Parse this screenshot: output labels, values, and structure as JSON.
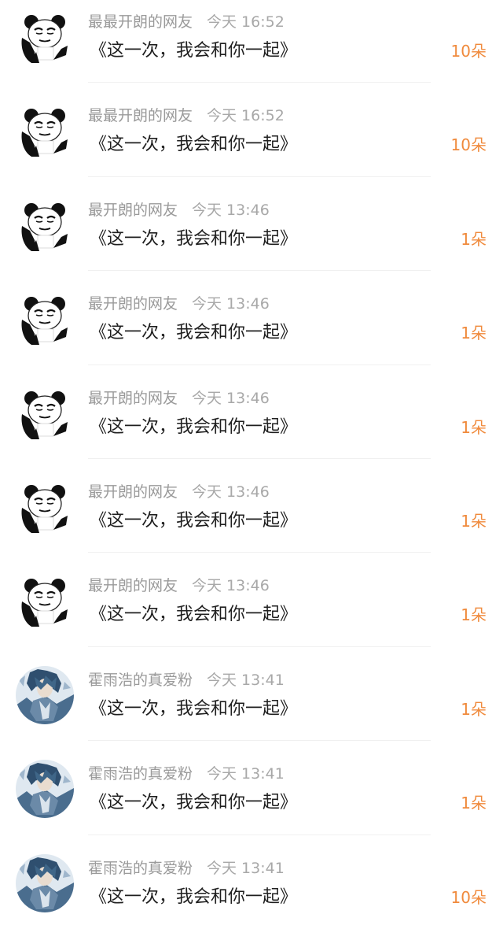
{
  "messages": [
    {
      "user": "最最开朗的网友",
      "time": "今天 16:52",
      "title": "《这一次，我会和你一起》",
      "gifts": "10朵",
      "avatar": "panda-avatar"
    },
    {
      "user": "最最开朗的网友",
      "time": "今天 16:52",
      "title": "《这一次，我会和你一起》",
      "gifts": "10朵",
      "avatar": "panda-avatar"
    },
    {
      "user": "最开朗的网友",
      "time": "今天 13:46",
      "title": "《这一次，我会和你一起》",
      "gifts": "1朵",
      "avatar": "panda-avatar"
    },
    {
      "user": "最开朗的网友",
      "time": "今天 13:46",
      "title": "《这一次，我会和你一起》",
      "gifts": "1朵",
      "avatar": "panda-avatar"
    },
    {
      "user": "最开朗的网友",
      "time": "今天 13:46",
      "title": "《这一次，我会和你一起》",
      "gifts": "1朵",
      "avatar": "panda-avatar"
    },
    {
      "user": "最开朗的网友",
      "time": "今天 13:46",
      "title": "《这一次，我会和你一起》",
      "gifts": "1朵",
      "avatar": "panda-avatar"
    },
    {
      "user": "最开朗的网友",
      "time": "今天 13:46",
      "title": "《这一次，我会和你一起》",
      "gifts": "1朵",
      "avatar": "panda-avatar"
    },
    {
      "user": "霍雨浩的真爱粉",
      "time": "今天 13:41",
      "title": "《这一次，我会和你一起》",
      "gifts": "1朵",
      "avatar": "anime-avatar"
    },
    {
      "user": "霍雨浩的真爱粉",
      "time": "今天 13:41",
      "title": "《这一次，我会和你一起》",
      "gifts": "1朵",
      "avatar": "anime-avatar"
    },
    {
      "user": "霍雨浩的真爱粉",
      "time": "今天 13:41",
      "title": "《这一次，我会和你一起》",
      "gifts": "10朵",
      "avatar": "anime-avatar"
    }
  ],
  "colors": {
    "gift": "#f08a3c",
    "meta": "#9a9a9a",
    "title": "#1f1f1f",
    "divider": "#f0f0f0"
  }
}
